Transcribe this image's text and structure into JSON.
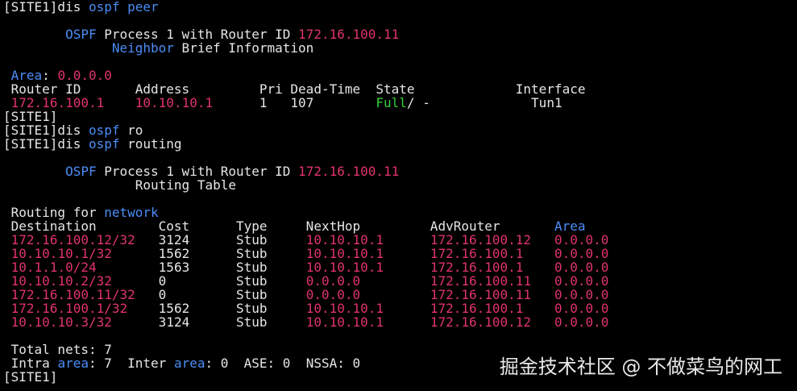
{
  "colors": {
    "background": "#000000",
    "text": "#e6e6e6",
    "keyword": "#4b8df6",
    "value": "#e0346a",
    "state_full": "#34d137"
  },
  "watermark": "掘金技术社区 @ 不做菜鸟的网工",
  "terminal": {
    "lines": [
      [
        {
          "t": "[SITE1]dis "
        },
        {
          "t": "ospf",
          "c": "keyword"
        },
        {
          "t": " "
        },
        {
          "t": "peer",
          "c": "keyword"
        }
      ],
      [],
      [
        {
          "t": "        "
        },
        {
          "t": "OSPF",
          "c": "keyword"
        },
        {
          "t": " Process 1 with Router ID "
        },
        {
          "t": "172.16.100.11",
          "c": "value"
        }
      ],
      [
        {
          "t": "              "
        },
        {
          "t": "Neighbor",
          "c": "keyword"
        },
        {
          "t": " Brief Information"
        }
      ],
      [],
      [
        {
          "t": " "
        },
        {
          "t": "Area",
          "c": "keyword"
        },
        {
          "t": ": "
        },
        {
          "t": "0.0.0.0",
          "c": "value"
        }
      ],
      [
        {
          "t": " Router ID       Address         Pri Dead-Time  State             Interface"
        }
      ],
      [
        {
          "t": " "
        },
        {
          "t": "172.16.100.1",
          "c": "value"
        },
        {
          "t": "    "
        },
        {
          "t": "10.10.10.1",
          "c": "value"
        },
        {
          "t": "      1   107        "
        },
        {
          "t": "Full",
          "c": "state_full"
        },
        {
          "t": "/ -             Tun1"
        }
      ],
      [
        {
          "t": "[SITE1]"
        }
      ],
      [
        {
          "t": "[SITE1]dis "
        },
        {
          "t": "ospf",
          "c": "keyword"
        },
        {
          "t": " ro"
        }
      ],
      [
        {
          "t": "[SITE1]dis "
        },
        {
          "t": "ospf",
          "c": "keyword"
        },
        {
          "t": " routing"
        }
      ],
      [],
      [
        {
          "t": "        "
        },
        {
          "t": "OSPF",
          "c": "keyword"
        },
        {
          "t": " Process 1 with Router ID "
        },
        {
          "t": "172.16.100.11",
          "c": "value"
        }
      ],
      [
        {
          "t": "                 Routing Table"
        }
      ],
      [],
      [
        {
          "t": " Routing for "
        },
        {
          "t": "network",
          "c": "keyword"
        }
      ],
      [
        {
          "t": " Destination        Cost      Type     NextHop         AdvRouter       "
        },
        {
          "t": "Area",
          "c": "keyword"
        }
      ],
      [
        {
          "t": " "
        },
        {
          "t": "172.16.100.12/32",
          "c": "value"
        },
        {
          "t": "   3124      Stub     "
        },
        {
          "t": "10.10.10.1",
          "c": "value"
        },
        {
          "t": "      "
        },
        {
          "t": "172.16.100.12",
          "c": "value"
        },
        {
          "t": "   "
        },
        {
          "t": "0.0.0.0",
          "c": "value"
        }
      ],
      [
        {
          "t": " "
        },
        {
          "t": "10.10.10.1/32",
          "c": "value"
        },
        {
          "t": "      1562      Stub     "
        },
        {
          "t": "10.10.10.1",
          "c": "value"
        },
        {
          "t": "      "
        },
        {
          "t": "172.16.100.1",
          "c": "value"
        },
        {
          "t": "    "
        },
        {
          "t": "0.0.0.0",
          "c": "value"
        }
      ],
      [
        {
          "t": " "
        },
        {
          "t": "10.1.1.0/24",
          "c": "value"
        },
        {
          "t": "        1563      Stub     "
        },
        {
          "t": "10.10.10.1",
          "c": "value"
        },
        {
          "t": "      "
        },
        {
          "t": "172.16.100.1",
          "c": "value"
        },
        {
          "t": "    "
        },
        {
          "t": "0.0.0.0",
          "c": "value"
        }
      ],
      [
        {
          "t": " "
        },
        {
          "t": "10.10.10.2/32",
          "c": "value"
        },
        {
          "t": "      0         Stub     "
        },
        {
          "t": "0.0.0.0",
          "c": "value"
        },
        {
          "t": "         "
        },
        {
          "t": "172.16.100.11",
          "c": "value"
        },
        {
          "t": "   "
        },
        {
          "t": "0.0.0.0",
          "c": "value"
        }
      ],
      [
        {
          "t": " "
        },
        {
          "t": "172.16.100.11/32",
          "c": "value"
        },
        {
          "t": "   0         Stub     "
        },
        {
          "t": "0.0.0.0",
          "c": "value"
        },
        {
          "t": "         "
        },
        {
          "t": "172.16.100.11",
          "c": "value"
        },
        {
          "t": "   "
        },
        {
          "t": "0.0.0.0",
          "c": "value"
        }
      ],
      [
        {
          "t": " "
        },
        {
          "t": "172.16.100.1/32",
          "c": "value"
        },
        {
          "t": "    1562      Stub     "
        },
        {
          "t": "10.10.10.1",
          "c": "value"
        },
        {
          "t": "      "
        },
        {
          "t": "172.16.100.1",
          "c": "value"
        },
        {
          "t": "    "
        },
        {
          "t": "0.0.0.0",
          "c": "value"
        }
      ],
      [
        {
          "t": " "
        },
        {
          "t": "10.10.10.3/32",
          "c": "value"
        },
        {
          "t": "      3124      Stub     "
        },
        {
          "t": "10.10.10.1",
          "c": "value"
        },
        {
          "t": "      "
        },
        {
          "t": "172.16.100.12",
          "c": "value"
        },
        {
          "t": "   "
        },
        {
          "t": "0.0.0.0",
          "c": "value"
        }
      ],
      [],
      [
        {
          "t": " Total nets: 7"
        }
      ],
      [
        {
          "t": " Intra "
        },
        {
          "t": "area",
          "c": "keyword"
        },
        {
          "t": ": 7  Inter "
        },
        {
          "t": "area",
          "c": "keyword"
        },
        {
          "t": ": 0  ASE: 0  NSSA: 0"
        }
      ],
      [
        {
          "t": "[SITE1]"
        }
      ]
    ]
  }
}
